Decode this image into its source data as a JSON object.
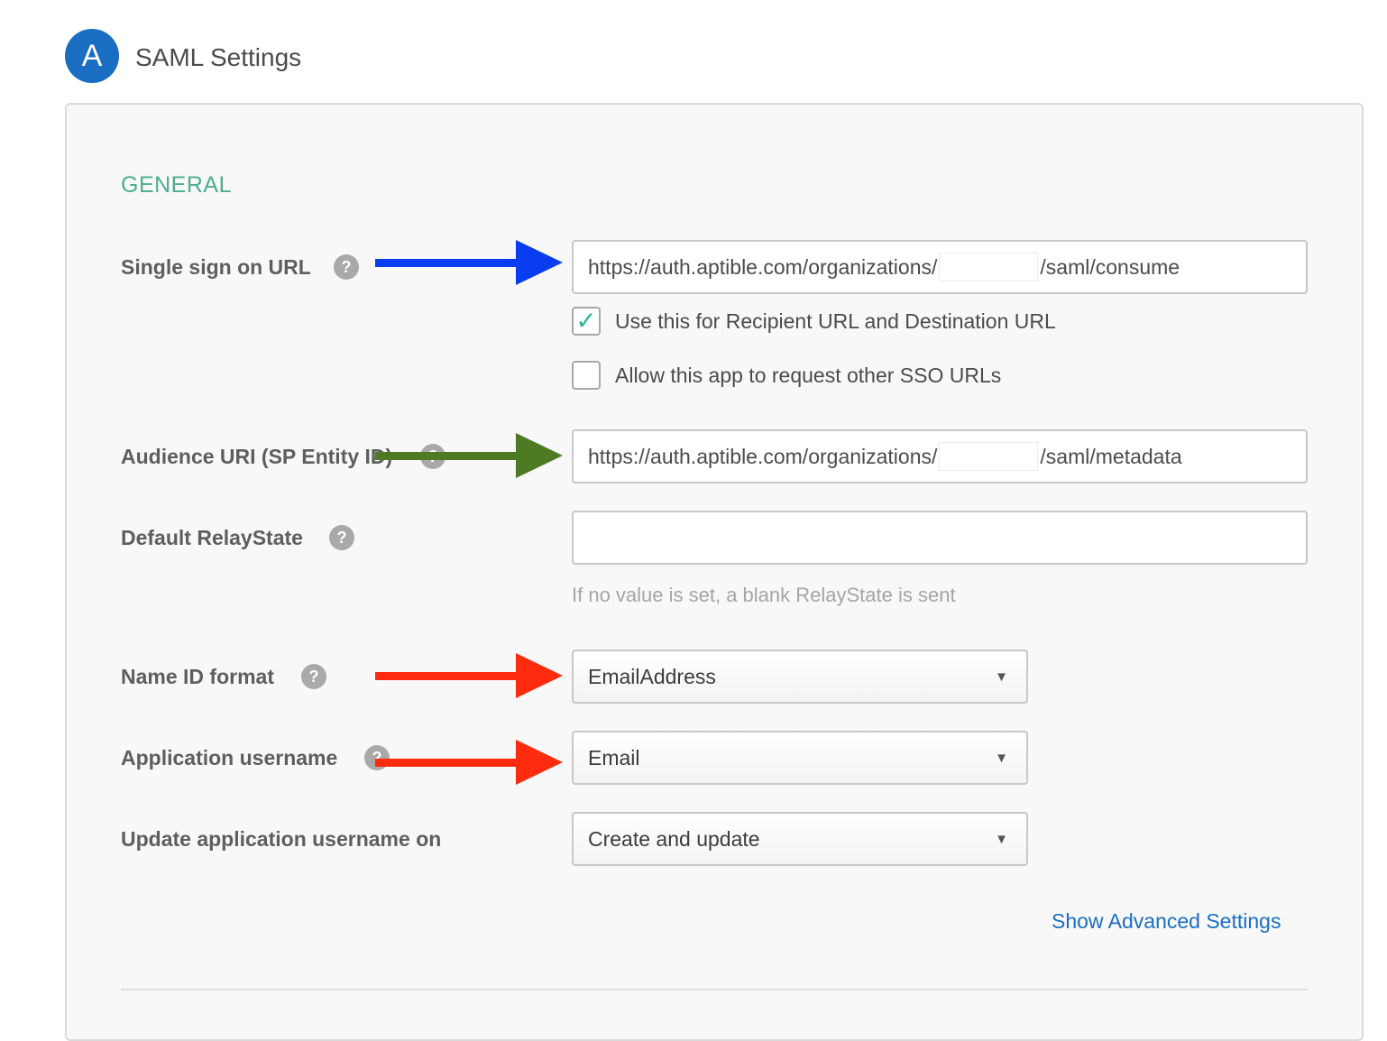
{
  "header": {
    "step_letter": "A",
    "title": "SAML Settings"
  },
  "section": {
    "title": "GENERAL"
  },
  "fields": {
    "sso_url": {
      "label": "Single sign on URL",
      "value_prefix": "https://auth.aptible.com/organizations/",
      "value_suffix": "/saml/consume"
    },
    "recipient_checkbox": {
      "label": "Use this for Recipient URL and Destination URL",
      "checked": true
    },
    "other_sso_checkbox": {
      "label": "Allow this app to request other SSO URLs",
      "checked": false
    },
    "audience_uri": {
      "label": "Audience URI (SP Entity ID)",
      "value_prefix": "https://auth.aptible.com/organizations/",
      "value_suffix": "/saml/metadata"
    },
    "relay_state": {
      "label": "Default RelayState",
      "value": "",
      "hint": "If no value is set, a blank RelayState is sent"
    },
    "name_id_format": {
      "label": "Name ID format",
      "selected": "EmailAddress"
    },
    "app_username": {
      "label": "Application username",
      "selected": "Email"
    },
    "update_username_on": {
      "label": "Update application username on",
      "selected": "Create and update"
    }
  },
  "help_icon_glyph": "?",
  "select_caret_glyph": "▼",
  "check_glyph": "✓",
  "advanced_link": "Show Advanced Settings",
  "annotation_colors": {
    "blue": "#0a3cf0",
    "green": "#4e7a24",
    "red": "#ff2b0f"
  },
  "colors": {
    "accent_blue": "#1a6ec1",
    "section_green": "#4cae8f",
    "check_green": "#2fb48e"
  }
}
